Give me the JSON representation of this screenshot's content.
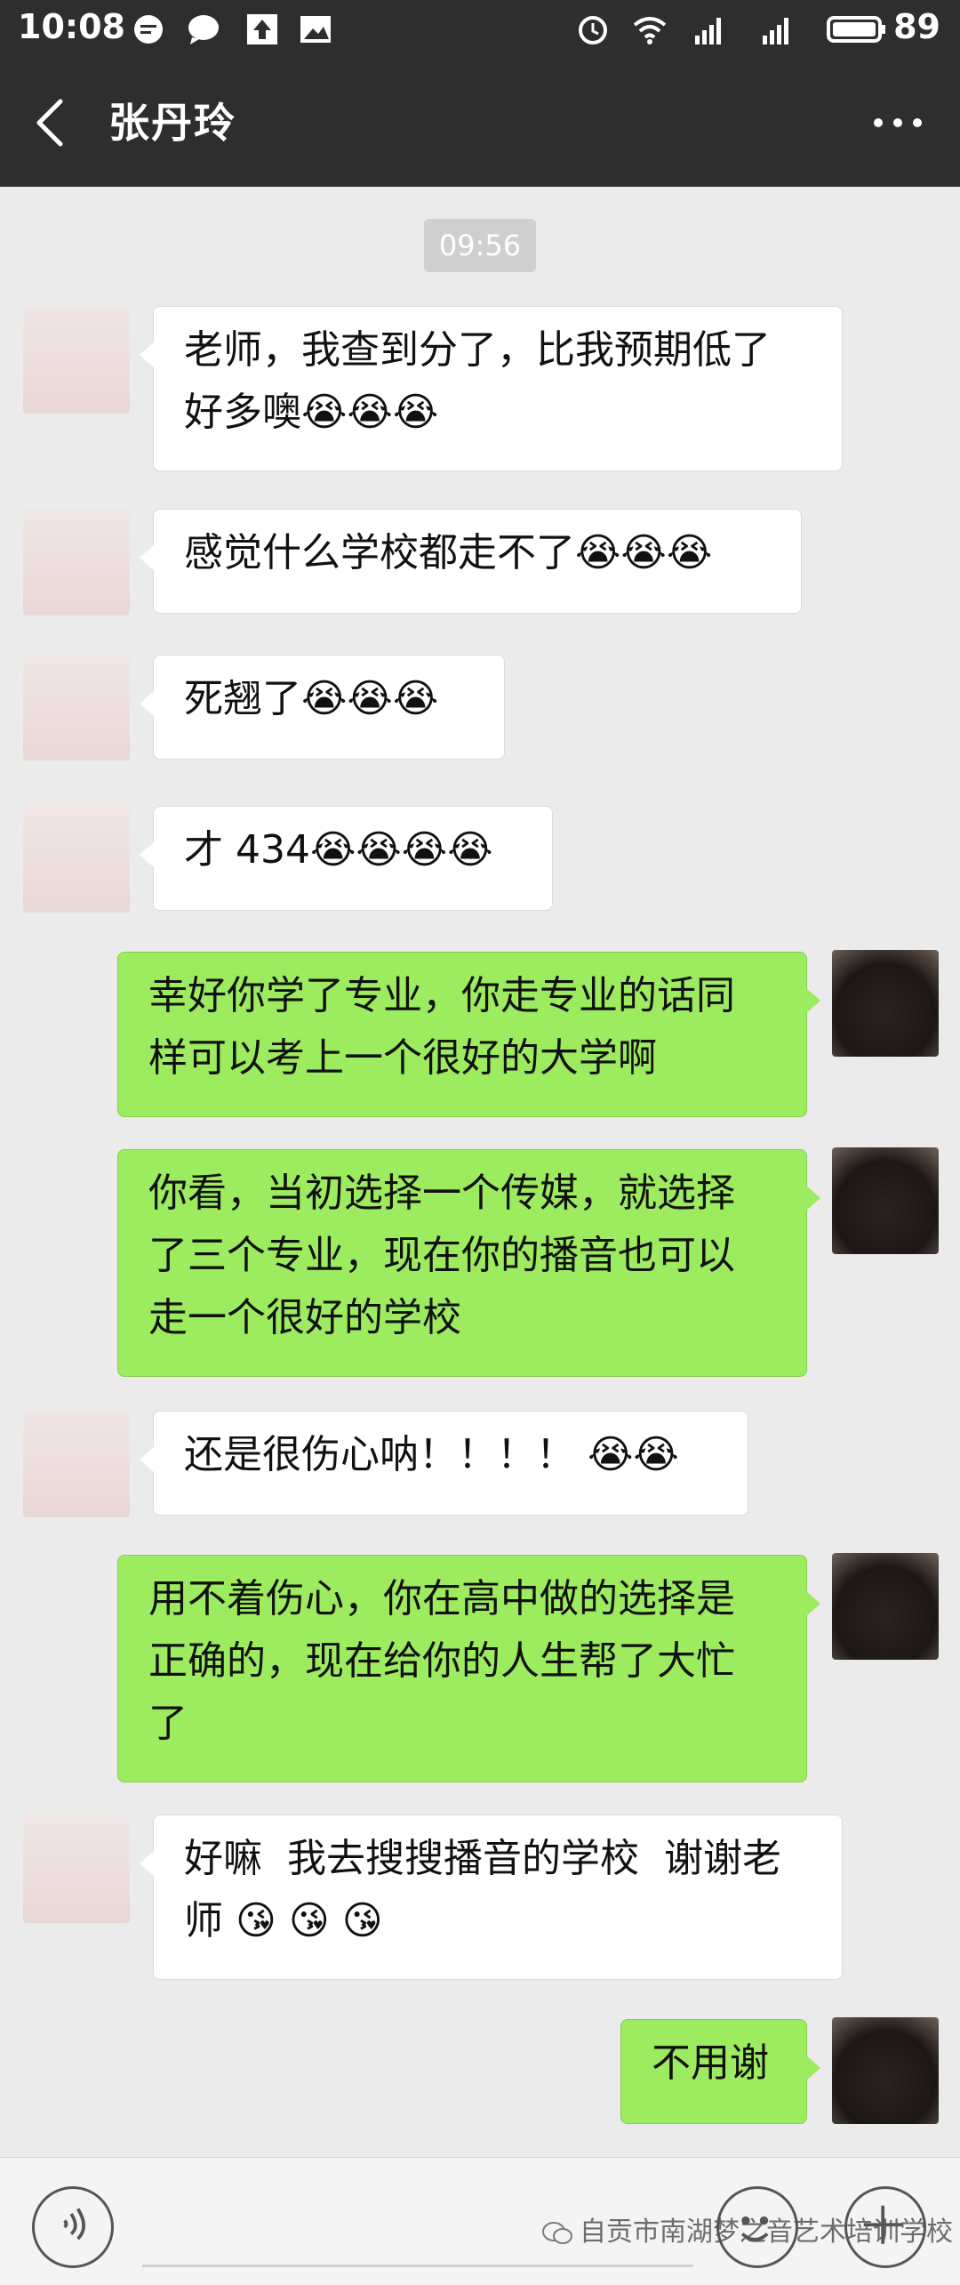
{
  "status_bar": {
    "time": "10:08",
    "battery": "89",
    "icons": [
      "chat-notification-icon",
      "message-icon",
      "upload-icon",
      "image-icon",
      "alarm-icon",
      "wifi-icon",
      "signal-4g-icon",
      "signal-icon",
      "battery-icon"
    ]
  },
  "header": {
    "title": "张丹玲",
    "back_icon": "chevron-left-icon",
    "more_icon": "more-dots-icon"
  },
  "chat": {
    "timestamp": "09:56",
    "messages": [
      {
        "side": "left",
        "text": "老师，我查到分了，比我预期低了\n好多噢😭😭😭"
      },
      {
        "side": "left",
        "text": "感觉什么学校都走不了😭😭😭"
      },
      {
        "side": "left",
        "text": "死翘了😭😭😭"
      },
      {
        "side": "left",
        "text": "才 434😭😭😭😭"
      },
      {
        "side": "right",
        "text": "幸好你学了专业，你走专业的话同\n样可以考上一个很好的大学啊"
      },
      {
        "side": "right",
        "text": "你看，当初选择一个传媒，就选择\n了三个专业，现在你的播音也可以\n走一个很好的学校"
      },
      {
        "side": "left",
        "text": "还是很伤心呐！！！！ 😭😭"
      },
      {
        "side": "right",
        "text": "用不着伤心，你在高中做的选择是\n正确的，现在给你的人生帮了大忙\n了"
      },
      {
        "side": "left",
        "text": "好嘛  我去搜搜播音的学校  谢谢老\n师 😘 😘 😘"
      },
      {
        "side": "right",
        "text": "不用谢"
      }
    ]
  },
  "bottom_bar": {
    "voice_icon": "voice-input-icon",
    "emoji_icon": "emoji-icon",
    "plus_icon": "plus-icon",
    "watermark": "自贡市南湖梦之音艺术培训学校"
  },
  "colors": {
    "header_bg": "#2e2e2e",
    "chat_bg": "#ebebeb",
    "bubble_self": "#9deb5f",
    "bubble_other": "#ffffff"
  }
}
